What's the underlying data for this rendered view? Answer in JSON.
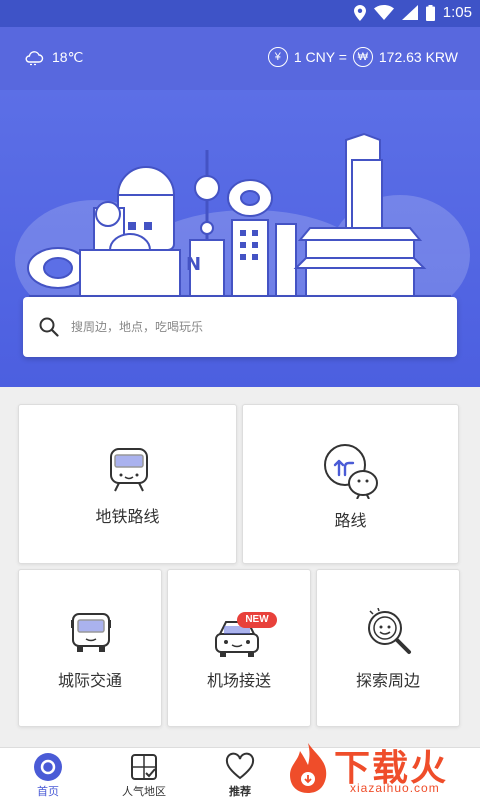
{
  "status_bar": {
    "time": "1:05",
    "icons": [
      "location-icon",
      "wifi-icon",
      "signal-icon",
      "battery-icon"
    ]
  },
  "top_bar": {
    "weather_icon": "cloud-icon",
    "temperature": "18℃",
    "rate_from_symbol": "¥",
    "rate_from": "1 CNY =",
    "rate_to_symbol": "₩",
    "rate_to": "172.63 KRW"
  },
  "search": {
    "placeholder": "搜周边，地点，吃喝玩乐"
  },
  "cards": {
    "subway": "地铁路线",
    "route": "路线",
    "intercity": "城际交通",
    "airport": "机场接送",
    "nearby": "探索周边",
    "new_badge": "NEW"
  },
  "tabs": [
    {
      "label": "首页",
      "active": true
    },
    {
      "label": "人气地区",
      "active": false
    },
    {
      "label": "推荐",
      "active": false
    }
  ],
  "watermark": {
    "text": "下载火",
    "sub": "xiazaihuo.com"
  },
  "colors": {
    "primary": "#5868de",
    "status": "#3e53c7",
    "accent": "#4a5bd6",
    "badge": "#e8413b"
  }
}
